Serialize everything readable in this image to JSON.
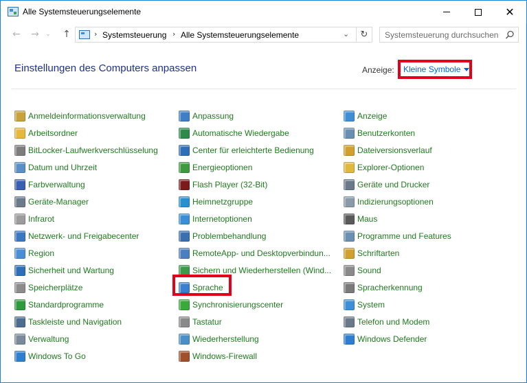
{
  "window": {
    "title": "Alle Systemsteuerungselemente",
    "accent": "#1883d7"
  },
  "nav": {
    "back_icon": "←",
    "forward_icon": "→",
    "recent_icon": "⌄",
    "up_icon": "↑"
  },
  "address": {
    "sep": "›",
    "crumbs": [
      "Systemsteuerung",
      "Alle Systemsteuerungselemente"
    ],
    "dropdown_icon": "⌄",
    "refresh_icon": "↻"
  },
  "search": {
    "placeholder": "Systemsteuerung durchsuchen"
  },
  "header": {
    "title": "Einstellungen des Computers anpassen",
    "view_label": "Anzeige:",
    "view_value": "Kleine Symbole",
    "highlight_color": "#e2001a"
  },
  "columns": [
    [
      {
        "label": "Anmeldeinformationsverwaltung",
        "icon": "credential-manager-icon",
        "color": "#c8a23a"
      },
      {
        "label": "Arbeitsordner",
        "icon": "work-folders-icon",
        "color": "#e5b93c"
      },
      {
        "label": "BitLocker-Laufwerkverschlüsselung",
        "icon": "bitlocker-icon",
        "color": "#7d7d7d"
      },
      {
        "label": "Datum und Uhrzeit",
        "icon": "date-time-icon",
        "color": "#5a8fc7"
      },
      {
        "label": "Farbverwaltung",
        "icon": "color-management-icon",
        "color": "#3b5fb0"
      },
      {
        "label": "Geräte-Manager",
        "icon": "device-manager-icon",
        "color": "#6b7b8c"
      },
      {
        "label": "Infrarot",
        "icon": "infrared-icon",
        "color": "#9c9c9c"
      },
      {
        "label": "Netzwerk- und Freigabecenter",
        "icon": "network-sharing-icon",
        "color": "#3a78c2"
      },
      {
        "label": "Region",
        "icon": "region-icon",
        "color": "#4a8fd6"
      },
      {
        "label": "Sicherheit und Wartung",
        "icon": "security-maintenance-icon",
        "color": "#2f6fb8"
      },
      {
        "label": "Speicherplätze",
        "icon": "storage-spaces-icon",
        "color": "#8c8c8c"
      },
      {
        "label": "Standardprogramme",
        "icon": "default-programs-icon",
        "color": "#2e9a3e"
      },
      {
        "label": "Taskleiste und Navigation",
        "icon": "taskbar-navigation-icon",
        "color": "#4f6d8f"
      },
      {
        "label": "Verwaltung",
        "icon": "administrative-tools-icon",
        "color": "#7a8a9a"
      },
      {
        "label": "Windows To Go",
        "icon": "windows-to-go-icon",
        "color": "#2f7fd0"
      }
    ],
    [
      {
        "label": "Anpassung",
        "icon": "personalization-icon",
        "color": "#3f7fc7"
      },
      {
        "label": "Automatische Wiedergabe",
        "icon": "autoplay-icon",
        "color": "#2f8a4a"
      },
      {
        "label": "Center für erleichterte Bedienung",
        "icon": "ease-of-access-icon",
        "color": "#2f6fb8"
      },
      {
        "label": "Energieoptionen",
        "icon": "power-options-icon",
        "color": "#3d9a3d"
      },
      {
        "label": "Flash Player (32-Bit)",
        "icon": "flash-player-icon",
        "color": "#7a1a1a"
      },
      {
        "label": "Heimnetzgruppe",
        "icon": "homegroup-icon",
        "color": "#2a8fd0"
      },
      {
        "label": "Internetoptionen",
        "icon": "internet-options-icon",
        "color": "#3a8fd6"
      },
      {
        "label": "Problembehandlung",
        "icon": "troubleshooting-icon",
        "color": "#3a6fb0"
      },
      {
        "label": "RemoteApp- und Desktopverbindun...",
        "icon": "remoteapp-icon",
        "color": "#4a7fc0"
      },
      {
        "label": "Sichern und Wiederherstellen (Wind...",
        "icon": "backup-restore-icon",
        "color": "#3d9a4a"
      },
      {
        "label": "Sprache",
        "icon": "language-icon",
        "color": "#3a7fd0"
      },
      {
        "label": "Synchronisierungscenter",
        "icon": "sync-center-icon",
        "color": "#3aa83a"
      },
      {
        "label": "Tastatur",
        "icon": "keyboard-icon",
        "color": "#8a8a8a"
      },
      {
        "label": "Wiederherstellung",
        "icon": "recovery-icon",
        "color": "#4a8fc7"
      },
      {
        "label": "Windows-Firewall",
        "icon": "firewall-icon",
        "color": "#a0502a"
      }
    ],
    [
      {
        "label": "Anzeige",
        "icon": "display-icon",
        "color": "#3f8fd6"
      },
      {
        "label": "Benutzerkonten",
        "icon": "user-accounts-icon",
        "color": "#6a8fb0"
      },
      {
        "label": "Dateiversionsverlauf",
        "icon": "file-history-icon",
        "color": "#d0a030"
      },
      {
        "label": "Explorer-Optionen",
        "icon": "explorer-options-icon",
        "color": "#e0b840"
      },
      {
        "label": "Geräte und Drucker",
        "icon": "devices-printers-icon",
        "color": "#6a7a8a"
      },
      {
        "label": "Indizierungsoptionen",
        "icon": "indexing-options-icon",
        "color": "#8a9aaa"
      },
      {
        "label": "Maus",
        "icon": "mouse-icon",
        "color": "#5a5a5a"
      },
      {
        "label": "Programme und Features",
        "icon": "programs-features-icon",
        "color": "#6a8fb0"
      },
      {
        "label": "Schriftarten",
        "icon": "fonts-icon",
        "color": "#d0a030"
      },
      {
        "label": "Sound",
        "icon": "sound-icon",
        "color": "#8a8a8a"
      },
      {
        "label": "Spracherkennung",
        "icon": "speech-recognition-icon",
        "color": "#7a7a7a"
      },
      {
        "label": "System",
        "icon": "system-icon",
        "color": "#3f8fd6"
      },
      {
        "label": "Telefon und Modem",
        "icon": "phone-modem-icon",
        "color": "#6a7a8a"
      },
      {
        "label": "Windows Defender",
        "icon": "windows-defender-icon",
        "color": "#2f7fd0"
      }
    ]
  ]
}
